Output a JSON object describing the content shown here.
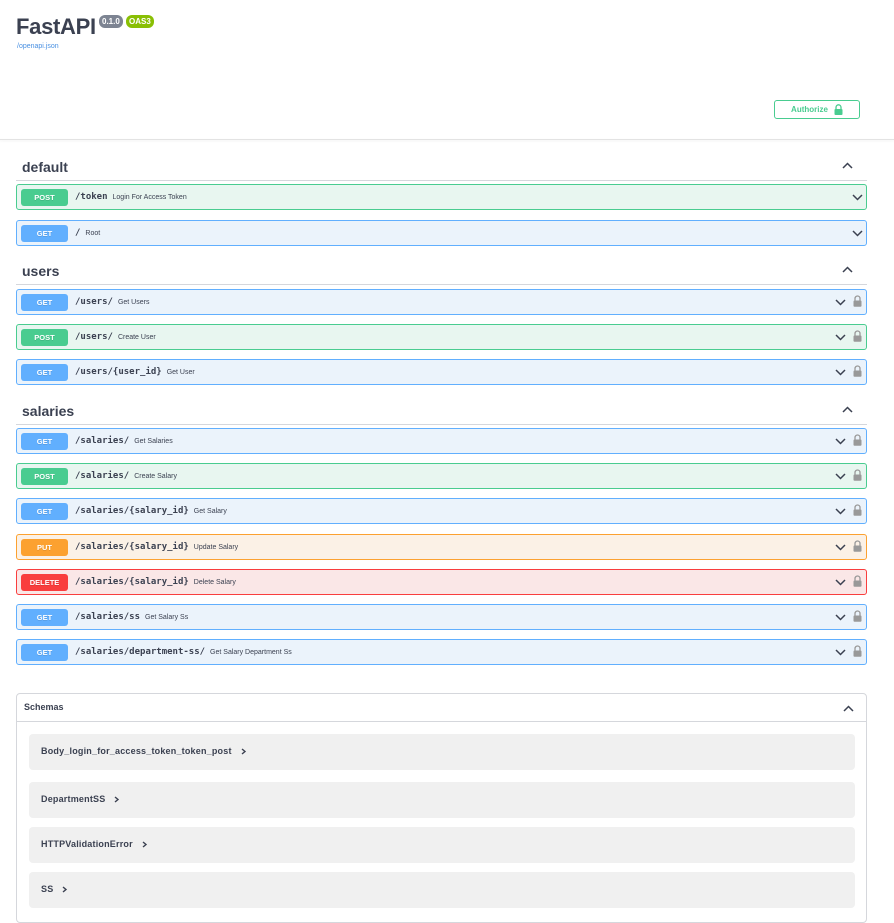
{
  "header": {
    "title": "FastAPI",
    "version_badge": "0.1.0",
    "oas_badge": "OAS3",
    "openapi_link": "/openapi.json",
    "authorize_label": "Authorize"
  },
  "tags": [
    {
      "name": "default",
      "operations": [
        {
          "method": "POST",
          "path": "/token",
          "summary": "Login For Access Token",
          "locked": false
        },
        {
          "method": "GET",
          "path": "/",
          "summary": "Root",
          "locked": false
        }
      ]
    },
    {
      "name": "users",
      "operations": [
        {
          "method": "GET",
          "path": "/users/",
          "summary": "Get Users",
          "locked": true
        },
        {
          "method": "POST",
          "path": "/users/",
          "summary": "Create User",
          "locked": true
        },
        {
          "method": "GET",
          "path": "/users/{user_id}",
          "summary": "Get User",
          "locked": true
        }
      ]
    },
    {
      "name": "salaries",
      "operations": [
        {
          "method": "GET",
          "path": "/salaries/",
          "summary": "Get Salaries",
          "locked": true
        },
        {
          "method": "POST",
          "path": "/salaries/",
          "summary": "Create Salary",
          "locked": true
        },
        {
          "method": "GET",
          "path": "/salaries/{salary_id}",
          "summary": "Get Salary",
          "locked": true
        },
        {
          "method": "PUT",
          "path": "/salaries/{salary_id}",
          "summary": "Update Salary",
          "locked": true
        },
        {
          "method": "DELETE",
          "path": "/salaries/{salary_id}",
          "summary": "Delete Salary",
          "locked": true
        },
        {
          "method": "GET",
          "path": "/salaries/ss",
          "summary": "Get Salary Ss",
          "locked": true
        },
        {
          "method": "GET",
          "path": "/salaries/department-ss/",
          "summary": "Get Salary Department Ss",
          "locked": true
        }
      ]
    }
  ],
  "schemas": {
    "label": "Schemas",
    "models": [
      "Body_login_for_access_token_token_post",
      "DepartmentSS",
      "HTTPValidationError",
      "SS"
    ]
  },
  "icons": {
    "lock": "lock-icon",
    "chevron": "chevron-icon",
    "model_expand": "chevron-right-icon"
  },
  "colors": {
    "get": "#61affe",
    "post": "#49cc90",
    "put": "#fca130",
    "delete": "#f93e3e"
  }
}
